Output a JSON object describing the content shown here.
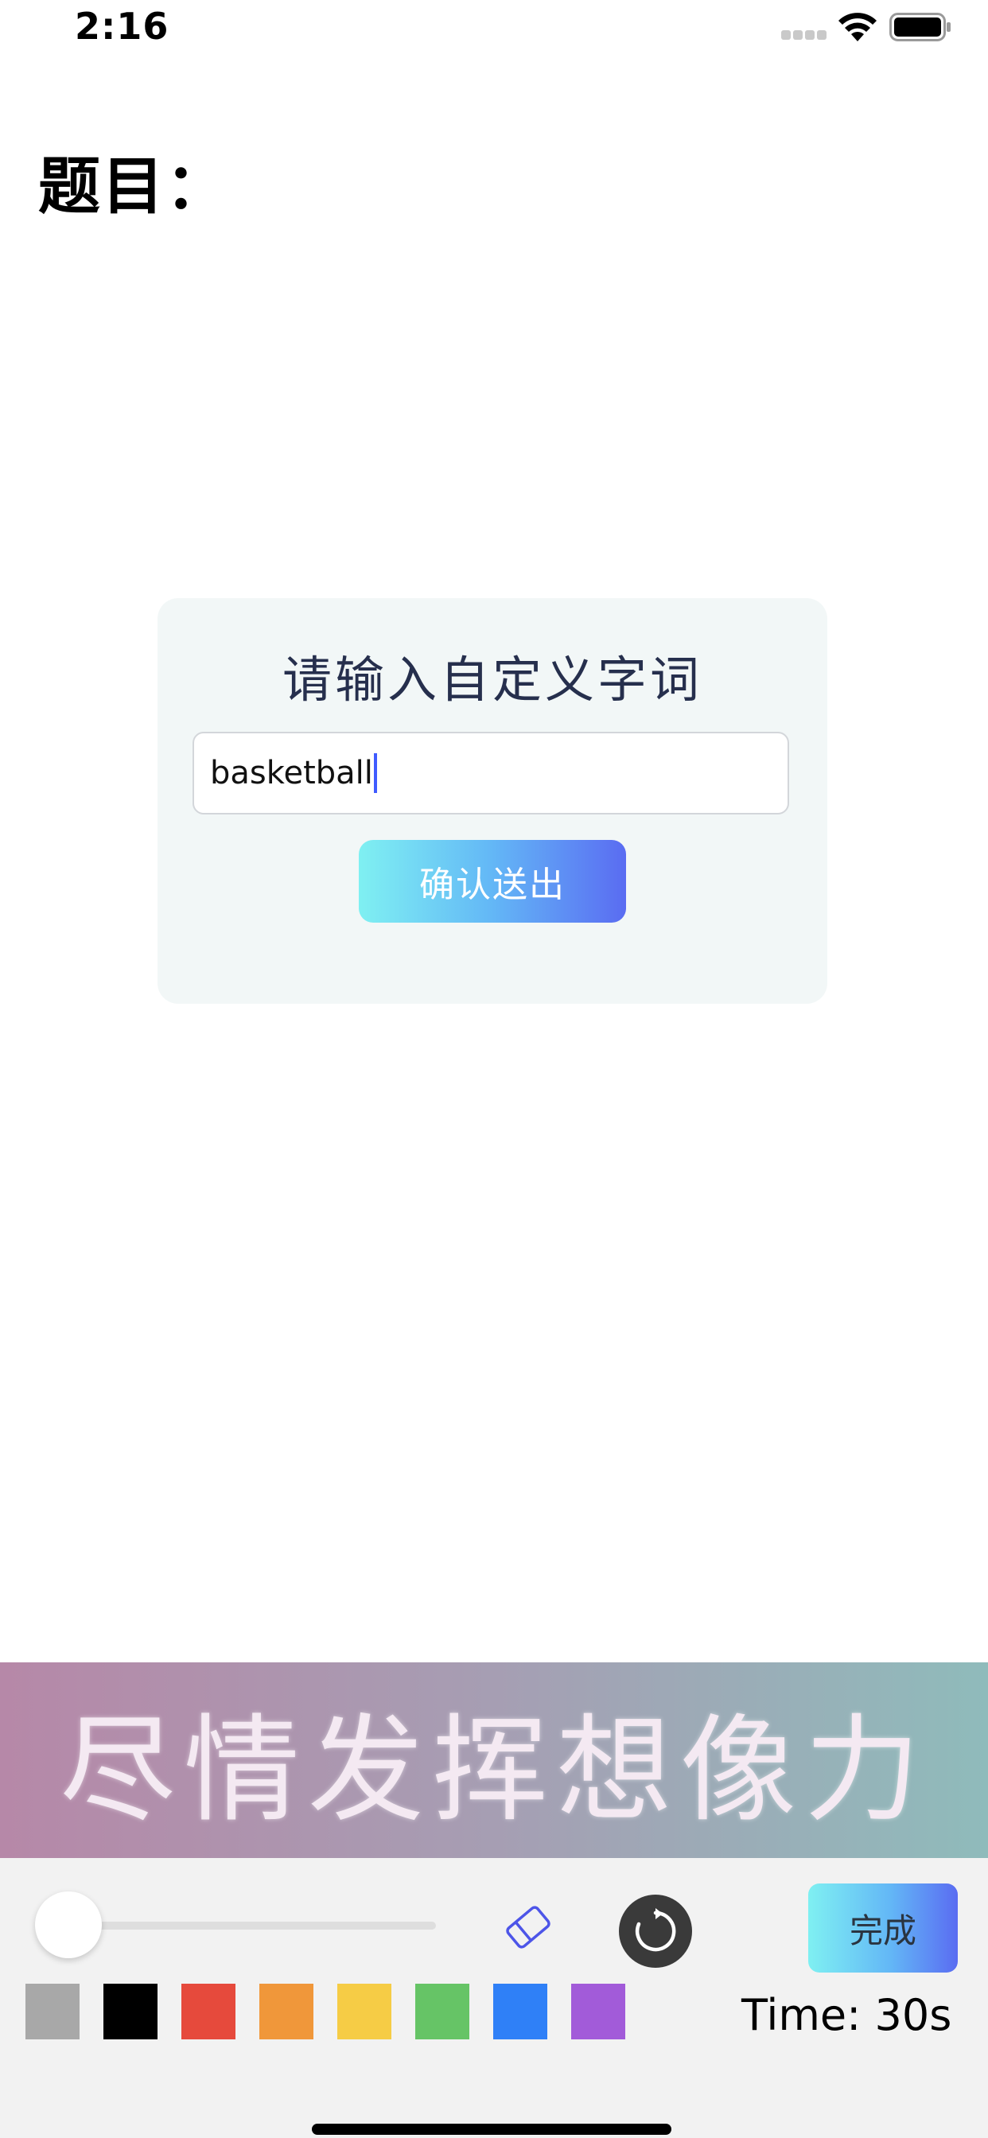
{
  "status_bar": {
    "time": "2:16"
  },
  "page": {
    "title": "题目："
  },
  "custom_word_card": {
    "title": "请输入自定义字词",
    "input_value": "basketball",
    "confirm_label": "确认送出"
  },
  "banner": {
    "text": "尽情发挥想像力"
  },
  "toolbar": {
    "done_label": "完成",
    "timer_text": "Time: 30s",
    "brush_size_level": 0,
    "colors": [
      "#a8a8a8",
      "#000000",
      "#e64a3c",
      "#f0973a",
      "#f6cc45",
      "#66c466",
      "#2f80f7",
      "#a25bd9"
    ],
    "icons": {
      "eraser": "eraser-icon",
      "refresh": "refresh-icon"
    }
  },
  "theme": {
    "accent_gradient": [
      "#7ff0f2",
      "#5a6cf2"
    ],
    "banner_gradient": [
      "#b688a8",
      "#8fbbbb"
    ],
    "card_bg": "#f2f7f7"
  }
}
